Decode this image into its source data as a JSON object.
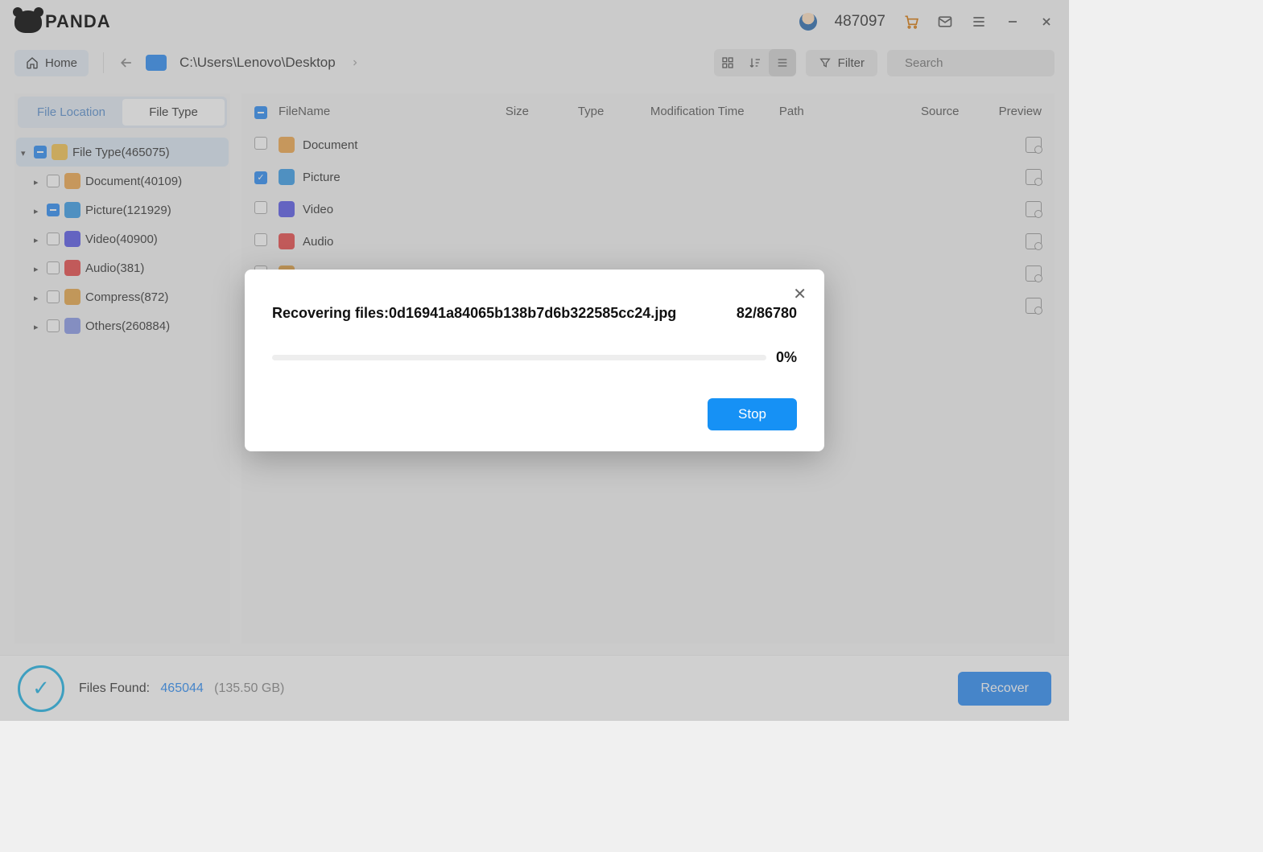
{
  "brand": "PANDA",
  "user_count": "487097",
  "toolbar": {
    "home": "Home",
    "path": "C:\\Users\\Lenovo\\Desktop",
    "filter": "Filter",
    "search_placeholder": "Search"
  },
  "sidebar": {
    "tabs": {
      "location": "File Location",
      "type": "File Type"
    },
    "root": "File Type(465075)",
    "items": [
      {
        "label": "Document(40109)"
      },
      {
        "label": "Picture(121929)"
      },
      {
        "label": "Video(40900)"
      },
      {
        "label": "Audio(381)"
      },
      {
        "label": "Compress(872)"
      },
      {
        "label": "Others(260884)"
      }
    ]
  },
  "columns": {
    "name": "FileName",
    "size": "Size",
    "type": "Type",
    "mod": "Modification Time",
    "path": "Path",
    "source": "Source",
    "preview": "Preview"
  },
  "rows": [
    {
      "label": "Document",
      "checked": false
    },
    {
      "label": "Picture",
      "checked": true
    },
    {
      "label": "Video",
      "checked": false
    },
    {
      "label": "Audio",
      "checked": false
    },
    {
      "label": "",
      "checked": false
    },
    {
      "label": "",
      "checked": false
    }
  ],
  "footer": {
    "label": "Files Found:",
    "count": "465044",
    "size": "(135.50 GB)",
    "recover": "Recover"
  },
  "modal": {
    "text": "Recovering files:0d16941a84065b138b7d6b322585cc24.jpg",
    "progress_count": "82/86780",
    "percent": "0%",
    "stop": "Stop"
  }
}
